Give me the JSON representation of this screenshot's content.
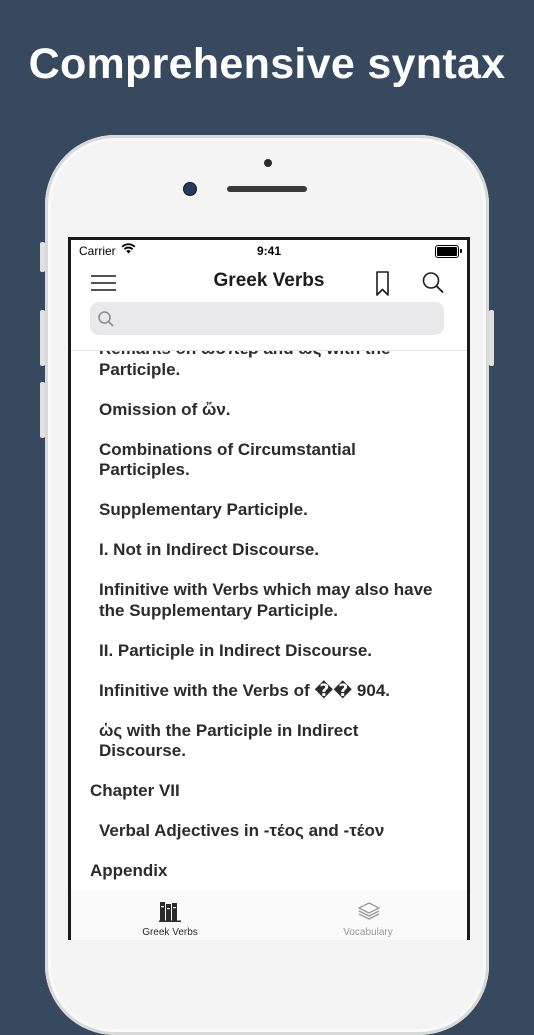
{
  "headline": "Comprehensive syntax",
  "status_bar": {
    "carrier": "Carrier",
    "time": "9:41"
  },
  "nav": {
    "title": "Greek Verbs"
  },
  "search": {
    "placeholder": "",
    "value": ""
  },
  "toc": [
    {
      "label": "Remarks on ὥσπερ and ὡς with the Participle.",
      "level": "section"
    },
    {
      "label": "Omission of ὤν.",
      "level": "section"
    },
    {
      "label": "Combinations of Circumstantial Participles.",
      "level": "section"
    },
    {
      "label": "Supplementary Participle.",
      "level": "section"
    },
    {
      "label": "I. Not in Indirect Discourse.",
      "level": "section"
    },
    {
      "label": "Infinitive with Verbs which may also have the Supplementary Participle.",
      "level": "section"
    },
    {
      "label": "II. Participle in Indirect Discourse.",
      "level": "section"
    },
    {
      "label": "Infinitive with the Verbs of �� 904.",
      "level": "section"
    },
    {
      "label": "ὡς with the Participle in Indirect Discourse.",
      "level": "section"
    },
    {
      "label": "Chapter VII",
      "level": "chapter"
    },
    {
      "label": "Verbal Adjectives in -τέος and -τέον",
      "level": "section"
    },
    {
      "label": "Appendix",
      "level": "chapter"
    }
  ],
  "tabs": [
    {
      "label": "Greek Verbs",
      "icon": "books-icon",
      "active": true
    },
    {
      "label": "Vocabulary",
      "icon": "stack-icon",
      "active": false
    }
  ],
  "colors": {
    "background": "#36495f",
    "active_tab": "#2b2b2b",
    "inactive_tab": "#9a9a9a"
  }
}
